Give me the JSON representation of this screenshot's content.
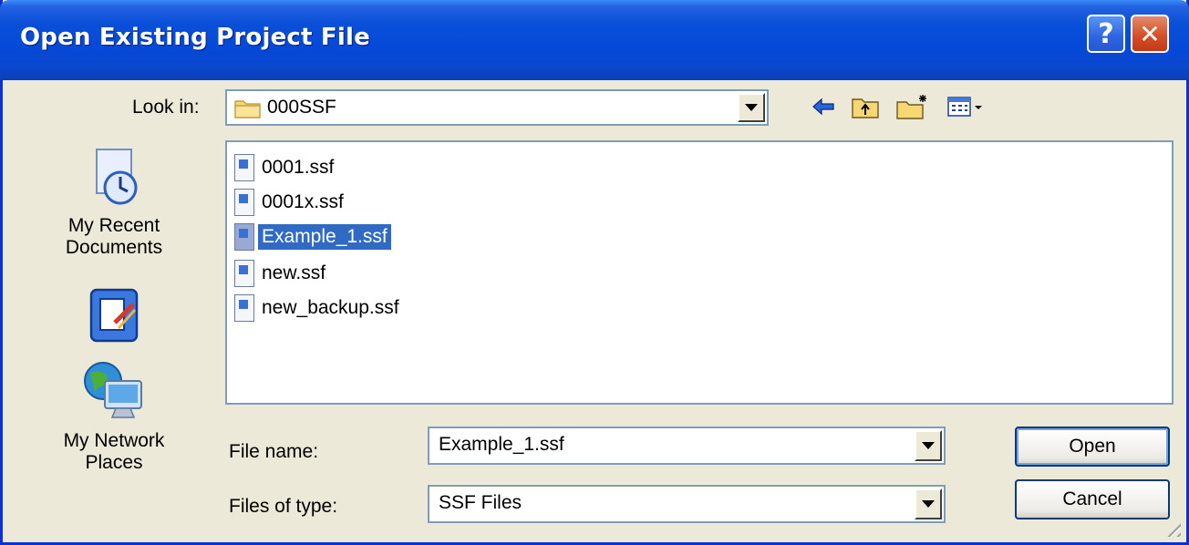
{
  "window": {
    "title": "Open Existing Project File",
    "help_glyph": "?",
    "close_glyph": "✕"
  },
  "look_in": {
    "label": "Look in:",
    "value": "000SSF"
  },
  "toolbar": {
    "back_icon": "back-arrow-icon",
    "up_icon": "up-folder-icon",
    "new_folder_icon": "new-folder-icon",
    "view_menu_icon": "view-menu-icon"
  },
  "places": [
    {
      "label": "My Recent Documents",
      "icon": "recent-documents-icon"
    },
    {
      "label": "",
      "icon": "desktop-icon"
    },
    {
      "label": "My Network Places",
      "icon": "network-places-icon"
    }
  ],
  "places_text": {
    "recent_line1": "My Recent",
    "recent_line2": "Documents",
    "network_line1": "My Network",
    "network_line2": "Places"
  },
  "files": [
    {
      "name": "0001.ssf",
      "selected": false
    },
    {
      "name": "0001x.ssf",
      "selected": false
    },
    {
      "name": "Example_1.ssf",
      "selected": true
    },
    {
      "name": "new.ssf",
      "selected": false
    },
    {
      "name": "new_backup.ssf",
      "selected": false
    }
  ],
  "file_name": {
    "label": "File name:",
    "value": "Example_1.ssf"
  },
  "file_type": {
    "label": "Files of type:",
    "value": "SSF Files"
  },
  "buttons": {
    "open": "Open",
    "cancel": "Cancel"
  },
  "colors": {
    "title_bar": "#0549d8",
    "selection": "#316ac5",
    "dialog_bg": "#ece9d8"
  }
}
